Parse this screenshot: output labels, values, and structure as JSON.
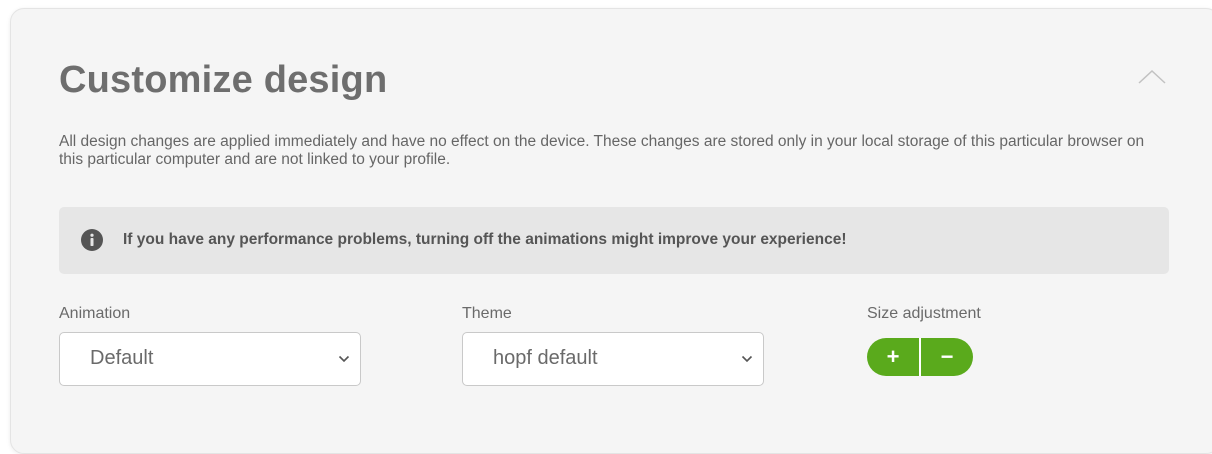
{
  "panel": {
    "title": "Customize design",
    "description": "All design changes are applied immediately and have no effect on the device. These changes are stored only in your local storage of this particular browser on this particular computer and are not linked to your profile.",
    "collapse_icon": "chevron-up-icon"
  },
  "notice": {
    "icon": "info-circle-icon",
    "text": "If you have any performance problems, turning off the animations might improve your experience!"
  },
  "animation": {
    "label": "Animation",
    "selected": "Default"
  },
  "theme": {
    "label": "Theme",
    "selected": "hopf default"
  },
  "size_adjustment": {
    "label": "Size adjustment",
    "increase_label": "+",
    "decrease_label": "−"
  },
  "colors": {
    "accent": "#5aaa1c",
    "panel_background": "#f5f5f5",
    "notice_background": "#e6e6e6"
  }
}
